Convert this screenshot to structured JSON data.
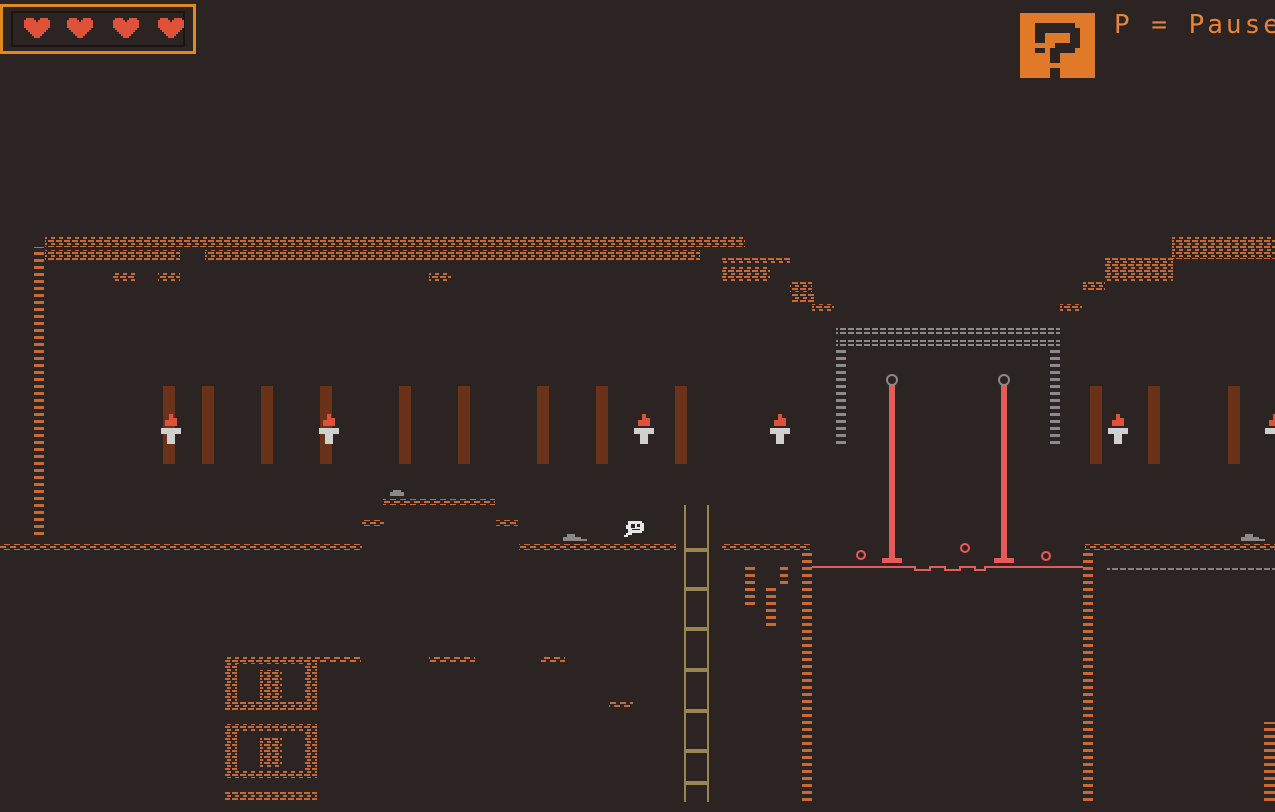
{
  "hud": {
    "hearts_total": 4,
    "hearts_filled": 4,
    "pause_hint": "P = Pause"
  },
  "icons": {
    "heart": "heart-icon",
    "help": "question-mark-icon",
    "player": "skull-character-icon",
    "torch": "torch-icon",
    "rock": "rock-icon",
    "ladder": "ladder-icon",
    "laser_pillar": "laser-pillar-icon"
  },
  "colors": {
    "background": "#2c2422",
    "brick": "#c86a36",
    "heart": "#e0513a",
    "hud_border": "#e08a1e",
    "help_button": "#e07a28",
    "pause_text": "#e8833a",
    "laser": "#e85a5a",
    "stone_frame": "#8a8a8a",
    "pillar": "#7a3a1e",
    "ladder": "#9a8450"
  }
}
